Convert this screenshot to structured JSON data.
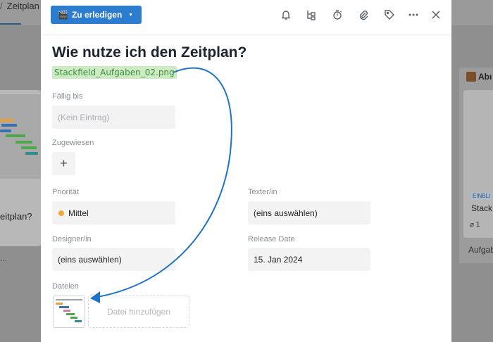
{
  "background": {
    "breadcrumb": {
      "separator": "/",
      "current": "Zeitplan"
    },
    "left_card": {
      "title_fragment": "eitplan?",
      "meta": "..."
    },
    "right_column": {
      "header_fragment": "Abı",
      "badge": "EINBLI",
      "card_title_fragment": "Stack",
      "meta_fragment": "1",
      "footer_fragment": "Aufgab"
    }
  },
  "header": {
    "status_label": "Zu erledigen",
    "status_icon": "film-clapper-icon",
    "icons": [
      "bell-icon",
      "subtask-tree-icon",
      "stopwatch-icon",
      "paperclip-icon",
      "tag-icon",
      "more-icon",
      "close-icon"
    ]
  },
  "task": {
    "title": "Wie nutze ich den Zeitplan?",
    "attachment_name": "Stackfield_Aufgaben_02.png"
  },
  "fields": {
    "due": {
      "label": "Fällig bis",
      "placeholder": "(Kein Eintrag)"
    },
    "assigned": {
      "label": "Zugewiesen",
      "add_symbol": "+"
    },
    "priority": {
      "label": "Priorität",
      "value": "Mittel",
      "color": "#f3a73b"
    },
    "writer": {
      "label": "Texter/in",
      "value": "(eins auswählen)"
    },
    "designer": {
      "label": "Designer/in",
      "value": "(eins auswählen)"
    },
    "release": {
      "label": "Release Date",
      "value": "15. Jan 2024"
    }
  },
  "files": {
    "label": "Dateien",
    "add_label": "Datei hinzufügen"
  },
  "colors": {
    "accent": "#2c7ccf",
    "attachment_bg": "#cdeac5",
    "attachment_text": "#3c8f3a",
    "annotation_arrow": "#1f74c9"
  }
}
